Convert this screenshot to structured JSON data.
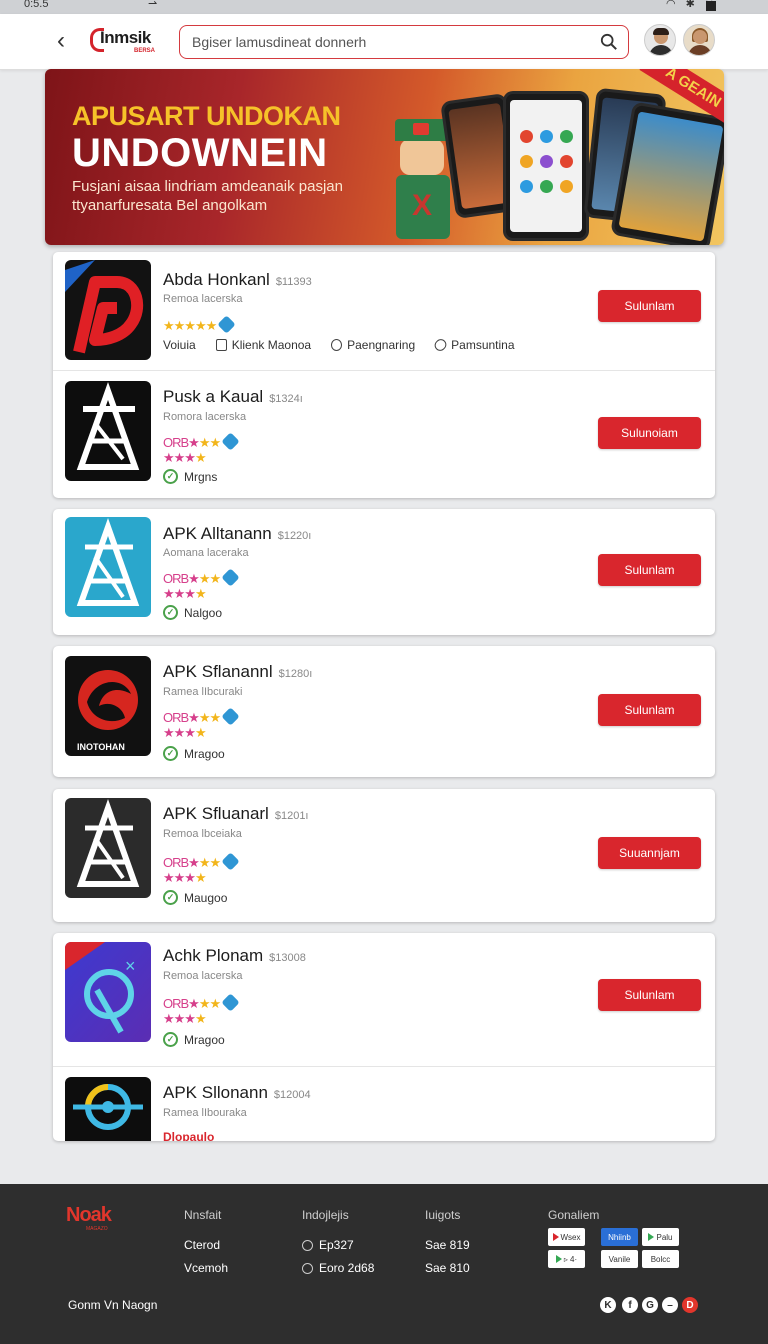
{
  "statusbar": {
    "time": "0:5.5",
    "arrow": "⇀"
  },
  "header": {
    "logo_text": "Inmsik",
    "logo_sub": "BERSA",
    "search_placeholder": "Bgiser lamusdineat donnerh"
  },
  "hero": {
    "title_line1": "APUSART UNDOKAN",
    "title_line2": "UNDOWNEIN",
    "subtitle": "Fusjani aisaa lindriam amdeanaik pasjan ttyanarfuresata Bel angolkam",
    "corner_badge": "A GEAIN"
  },
  "apps": [
    {
      "name": "Abda Honkanl",
      "num": "$11393",
      "sub": "Remoa lacerska",
      "button": "Sulunlam",
      "meta": [
        "Voiuia",
        "Klienk Maonoa",
        "Paengnaring",
        "Pamsuntina"
      ]
    },
    {
      "name": "Pusk a Kaual",
      "num": "$1324ı",
      "sub": "Romora lacerska",
      "button": "Sulunoiam",
      "status": "Mrgns"
    },
    {
      "name": "APK Alltanann",
      "num": "$1220ı",
      "sub": "Aomana laceraka",
      "button": "Sulunlam",
      "status": "Nalgoo"
    },
    {
      "name": "APK Sflanannl",
      "num": "$1280ı",
      "sub": "Ramea lIbcuraki",
      "button": "Sulunlam",
      "status": "Mragoo",
      "icon_label": "INOTOHAN"
    },
    {
      "name": "APK Sfluanarl",
      "num": "$1201ı",
      "sub": "Remoa lbceiaka",
      "button": "Suuannjam",
      "status": "Maugoo"
    },
    {
      "name": "Achk Plonam",
      "num": "$13008",
      "sub": "Remoa lacerska",
      "button": "Sulunlam",
      "status": "Mragoo"
    },
    {
      "name": "APK Sllonann",
      "num": "$12004",
      "sub": "Ramea lIbouraka",
      "bottom_text": "Dlopaulo"
    }
  ],
  "rating_text": {
    "prefix": "ORB"
  },
  "footer": {
    "logo": "Noak",
    "logo_sub": "MAGAZO",
    "columns": [
      {
        "heading": "Nnsfait",
        "items": [
          "Cterod",
          "Vcemoh"
        ]
      },
      {
        "heading": "Indojlejis",
        "items": [
          "Ep327",
          "Eoro 2d68"
        ]
      },
      {
        "heading": "Iuigots",
        "items": [
          "Sae 819",
          "Sae 810"
        ]
      },
      {
        "heading": "Gonaliem",
        "items": []
      }
    ],
    "stores": [
      "Wsex",
      "Nhiinb",
      "Palu",
      "▹ 4·",
      "Vanile",
      "Bolcc"
    ],
    "bottom_text": "Gonm Vn Naogn",
    "socials": [
      "K",
      "f",
      "G",
      "–",
      "D"
    ]
  },
  "colors": {
    "accent": "#d9262d",
    "footer_bg": "#2e2e2e",
    "page_bg": "#e9eaec"
  }
}
